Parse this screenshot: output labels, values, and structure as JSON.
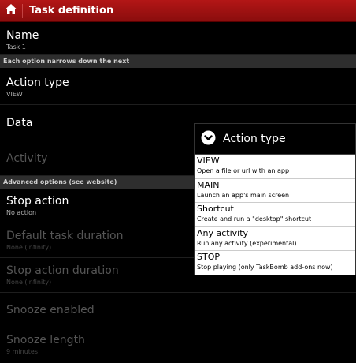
{
  "header": {
    "title": "Task definition",
    "home_icon": "home-icon",
    "background_color": "#a31212"
  },
  "preferences": {
    "name": {
      "title": "Name",
      "summary": "Task 1"
    },
    "category_1": "Each option narrows down the next",
    "action_type": {
      "title": "Action type",
      "summary": "VIEW"
    },
    "data": {
      "title": "Data"
    },
    "activity": {
      "title": "Activity"
    },
    "category_2": "Advanced options (see website)",
    "stop_action": {
      "title": "Stop action",
      "summary": "No action"
    },
    "default_task_duration": {
      "title": "Default task duration",
      "summary": "None (infinity)"
    },
    "stop_action_duration": {
      "title": "Stop action duration",
      "summary": "None (infinity)"
    },
    "snooze_enabled": {
      "title": "Snooze enabled"
    },
    "snooze_length": {
      "title": "Snooze length",
      "summary": "9 minutes"
    }
  },
  "dialog": {
    "title": "Action type",
    "icon": "chevron-down-icon",
    "options": [
      {
        "label": "VIEW",
        "description": "Open a file or url with an app"
      },
      {
        "label": "MAIN",
        "description": "Launch an app's main screen"
      },
      {
        "label": "Shortcut",
        "description": "Create and run a \"desktop\" shortcut"
      },
      {
        "label": "Any activity",
        "description": "Run any activity (experimental)"
      },
      {
        "label": "STOP",
        "description": "Stop playing (only TaskBomb add-ons now)"
      }
    ]
  }
}
